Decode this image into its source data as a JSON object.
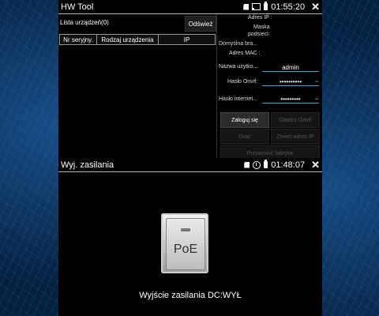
{
  "window1": {
    "title": "HW Tool",
    "time": "01:55:20",
    "device_list_label": "Lista urządzeń(0)",
    "refresh_label": "Odśwież",
    "columns": [
      "Nr seryjny.",
      "Rodzaj urządzenia",
      "IP"
    ],
    "info": {
      "ip_label": "Adres IP :",
      "mask_label_1": "Maska",
      "mask_label_2": "podsieci:",
      "gateway_label": "Domyślna bra...",
      "mac_label": "Adres MAC :"
    },
    "username_label": "Nazwa użytko...",
    "username_value": "admin",
    "onvif_password_label": "Hasło Onvif:",
    "onvif_password_value": "••••••••••",
    "internet_password_label": "Hasło internet...",
    "internet_password_value": "•••••••••",
    "buttons": {
      "login": "Zaloguj się",
      "open_onvif": "Otwórz Onvif",
      "play": "Grać",
      "change_ip": "Zmień adres IP",
      "factory_reset": "Przywrócić fabryke"
    }
  },
  "window2": {
    "title": "Wyj. zasilania",
    "time": "01:48:07",
    "poe_label": "PoE",
    "status_text": "Wyjście zasilania DC:WYŁ"
  },
  "icons": [
    "sd-card-icon",
    "cast-icon",
    "battery-icon",
    "clock-icon",
    "close-icon",
    "eye-icon"
  ],
  "colors": {
    "accent": "#4aa3d8",
    "window_bg": "#000000",
    "background": "#062040"
  }
}
